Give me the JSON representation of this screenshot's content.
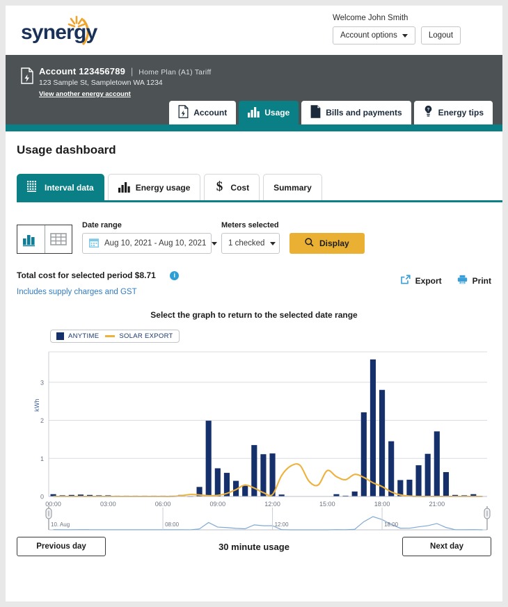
{
  "header": {
    "logo_text": "synergy",
    "welcome": "Welcome John Smith",
    "account_options_label": "Account options",
    "logout_label": "Logout"
  },
  "account_band": {
    "account_label": "Account",
    "account_number": "123456789",
    "separator": "|",
    "tariff": "Home Plan (A1) Tariff",
    "address": "123 Sample St, Sampletown WA 1234",
    "switch_link": "View another energy account",
    "nav": [
      {
        "label": "Account",
        "icon": "document-bolt-icon",
        "active": false
      },
      {
        "label": "Usage",
        "icon": "bar-chart-icon",
        "active": true
      },
      {
        "label": "Bills and payments",
        "icon": "bill-icon",
        "active": false
      },
      {
        "label": "Energy tips",
        "icon": "lightbulb-icon",
        "active": false
      }
    ]
  },
  "page": {
    "title": "Usage dashboard",
    "subtabs": [
      {
        "label": "Interval data",
        "icon": "grid-chart-icon",
        "active": true
      },
      {
        "label": "Energy usage",
        "icon": "bar-chart-icon",
        "active": false
      },
      {
        "label": "Cost",
        "icon": "dollar-icon",
        "active": false
      },
      {
        "label": "Summary",
        "icon": "",
        "active": false
      }
    ]
  },
  "controls": {
    "view_chart_icon": "bar-chart-icon",
    "view_table_icon": "table-icon",
    "date_range_label": "Date range",
    "date_range_value": "Aug 10, 2021 - Aug 10, 2021",
    "meters_label": "Meters selected",
    "meters_value": "1 checked",
    "display_label": "Display"
  },
  "cost": {
    "total_text": "Total cost for selected period $8.71",
    "info_icon": "info-icon",
    "includes_text": "Includes supply charges and GST",
    "export_label": "Export",
    "print_label": "Print"
  },
  "graph_note": "Select the graph to return to the selected date range",
  "footer": {
    "previous_label": "Previous day",
    "middle_label": "30 minute usage",
    "next_label": "Next day"
  },
  "navigator": {
    "left_label": "10. Aug",
    "mid_labels": [
      "08:00",
      "12:00",
      "18:00"
    ]
  },
  "colors": {
    "teal": "#0a7f85",
    "dark_band": "#4d5355",
    "bar_navy": "#16306b",
    "solar_gold": "#eeb13b",
    "display_amber": "#eab033",
    "link_blue": "#2e7cc4",
    "info_blue": "#2e9fd4"
  },
  "chart_data": {
    "type": "bar",
    "title": "",
    "xlabel": "",
    "ylabel": "kWh",
    "ylim": [
      0,
      3.8
    ],
    "yticks": [
      0,
      1,
      2,
      3
    ],
    "grid": true,
    "legend_position": "top-left",
    "xticks": [
      "00:00",
      "03:00",
      "06:00",
      "09:00",
      "12:00",
      "15:00",
      "18:00",
      "21:00"
    ],
    "x": [
      "00:00",
      "00:30",
      "01:00",
      "01:30",
      "02:00",
      "02:30",
      "03:00",
      "03:30",
      "04:00",
      "04:30",
      "05:00",
      "05:30",
      "06:00",
      "06:30",
      "07:00",
      "07:30",
      "08:00",
      "08:30",
      "09:00",
      "09:30",
      "10:00",
      "10:30",
      "11:00",
      "11:30",
      "12:00",
      "12:30",
      "13:00",
      "13:30",
      "14:00",
      "14:30",
      "15:00",
      "15:30",
      "16:00",
      "16:30",
      "17:00",
      "17:30",
      "18:00",
      "18:30",
      "19:00",
      "19:30",
      "20:00",
      "20:30",
      "21:00",
      "21:30",
      "22:00",
      "22:30",
      "23:00",
      "23:30"
    ],
    "series": [
      {
        "name": "ANYTIME",
        "type": "bar",
        "color": "#16306b",
        "values": [
          0.06,
          0.03,
          0.04,
          0.05,
          0.04,
          0.03,
          0.03,
          0.02,
          0.02,
          0.02,
          0.02,
          0.02,
          0.02,
          0.02,
          0.04,
          0.01,
          0.25,
          1.99,
          0.74,
          0.62,
          0.41,
          0.28,
          1.35,
          1.11,
          1.13,
          0.05,
          0.0,
          0.0,
          0.0,
          0.0,
          0.0,
          0.06,
          0.02,
          0.13,
          2.21,
          3.6,
          2.8,
          1.45,
          0.43,
          0.44,
          0.82,
          1.12,
          1.71,
          0.64,
          0.04,
          0.03,
          0.06,
          0.0
        ]
      },
      {
        "name": "SOLAR EXPORT",
        "type": "line",
        "color": "#eeb13b",
        "values": [
          0,
          0,
          0,
          0,
          0,
          0,
          0,
          0,
          0,
          0,
          0,
          0,
          0,
          0,
          0.02,
          0.05,
          0.04,
          0.02,
          0.03,
          0.08,
          0.18,
          0.3,
          0.22,
          0.1,
          0.05,
          0.55,
          0.8,
          0.82,
          0.4,
          0.3,
          0.68,
          0.52,
          0.44,
          0.58,
          0.5,
          0.36,
          0.26,
          0.12,
          0.04,
          0.01,
          0,
          0,
          0,
          0,
          0,
          0,
          0,
          0
        ]
      }
    ]
  }
}
